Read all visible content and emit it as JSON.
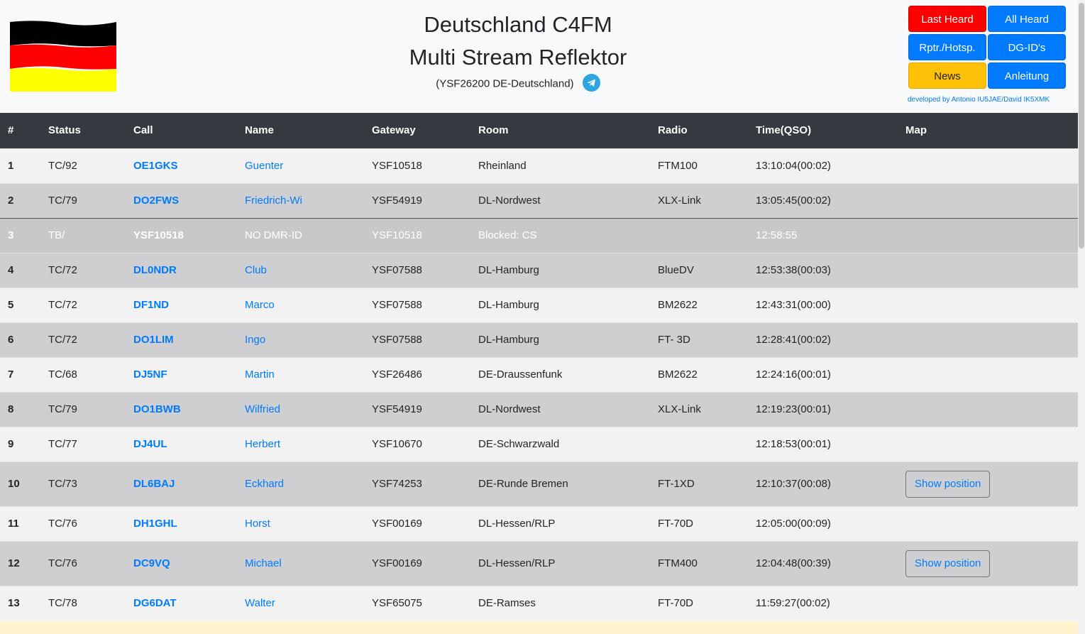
{
  "header": {
    "title_line1": "Deutschland C4FM",
    "title_line2": "Multi Stream Reflektor",
    "subtitle": "(YSF26200 DE-Deutschland)",
    "developer_credit": "developed by Antonio IU5JAE/David IK5XMK"
  },
  "nav": {
    "last_heard": "Last Heard",
    "all_heard": "All Heard",
    "rptr_hotsp": "Rptr./Hotsp.",
    "dg_ids": "DG-ID's",
    "news": "News",
    "anleitung": "Anleitung"
  },
  "table": {
    "headers": [
      "#",
      "Status",
      "Call",
      "Name",
      "Gateway",
      "Room",
      "Radio",
      "Time(QSO)",
      "Map"
    ],
    "rows": [
      {
        "num": "1",
        "status": "TC/92",
        "call": "OE1GKS",
        "name": "Guenter",
        "gateway": "YSF10518",
        "room": "Rheinland",
        "radio": "FTM100",
        "time": "13:10:04(00:02)",
        "map": ""
      },
      {
        "num": "2",
        "status": "TC/79",
        "call": "DO2FWS",
        "name": "Friedrich-Wi",
        "gateway": "YSF54919",
        "room": "DL-Nordwest",
        "radio": "XLX-Link",
        "time": "13:05:45(00:02)",
        "map": ""
      },
      {
        "num": "3",
        "status": "TB/",
        "call": "YSF10518",
        "name": "NO DMR-ID",
        "gateway": "YSF10518",
        "room": "Blocked: CS",
        "radio": "",
        "time": "12:58:55",
        "map": ""
      },
      {
        "num": "4",
        "status": "TC/72",
        "call": "DL0NDR",
        "name": "Club",
        "gateway": "YSF07588",
        "room": "DL-Hamburg",
        "radio": "BlueDV",
        "time": "12:53:38(00:03)",
        "map": ""
      },
      {
        "num": "5",
        "status": "TC/72",
        "call": "DF1ND",
        "name": "Marco",
        "gateway": "YSF07588",
        "room": "DL-Hamburg",
        "radio": "BM2622",
        "time": "12:43:31(00:00)",
        "map": ""
      },
      {
        "num": "6",
        "status": "TC/72",
        "call": "DO1LIM",
        "name": "Ingo",
        "gateway": "YSF07588",
        "room": "DL-Hamburg",
        "radio": "FT- 3D",
        "time": "12:28:41(00:02)",
        "map": ""
      },
      {
        "num": "7",
        "status": "TC/68",
        "call": "DJ5NF",
        "name": "Martin",
        "gateway": "YSF26486",
        "room": "DE-Draussenfunk",
        "radio": "BM2622",
        "time": "12:24:16(00:01)",
        "map": ""
      },
      {
        "num": "8",
        "status": "TC/79",
        "call": "DO1BWB",
        "name": "Wilfried",
        "gateway": "YSF54919",
        "room": "DL-Nordwest",
        "radio": "XLX-Link",
        "time": "12:19:23(00:01)",
        "map": ""
      },
      {
        "num": "9",
        "status": "TC/77",
        "call": "DJ4UL",
        "name": "Herbert",
        "gateway": "YSF10670",
        "room": "DE-Schwarzwald",
        "radio": "",
        "time": "12:18:53(00:01)",
        "map": ""
      },
      {
        "num": "10",
        "status": "TC/73",
        "call": "DL6BAJ",
        "name": "Eckhard",
        "gateway": "YSF74253",
        "room": "DE-Runde Bremen",
        "radio": "FT-1XD",
        "time": "12:10:37(00:08)",
        "map": "Show position"
      },
      {
        "num": "11",
        "status": "TC/76",
        "call": "DH1GHL",
        "name": "Horst",
        "gateway": "YSF00169",
        "room": "DL-Hessen/RLP",
        "radio": "FT-70D",
        "time": "12:05:00(00:09)",
        "map": ""
      },
      {
        "num": "12",
        "status": "TC/76",
        "call": "DC9VQ",
        "name": "Michael",
        "gateway": "YSF00169",
        "room": "DL-Hessen/RLP",
        "radio": "FTM400",
        "time": "12:04:48(00:39)",
        "map": "Show position"
      },
      {
        "num": "13",
        "status": "TC/78",
        "call": "DG6DAT",
        "name": "Walter",
        "gateway": "YSF65075",
        "room": "DE-Ramses",
        "radio": "FT-70D",
        "time": "11:59:27(00:02)",
        "map": ""
      }
    ]
  },
  "colors": {
    "accent": "#007bff",
    "header_bg": "#343a40",
    "last_heard_btn": "#ff0000",
    "news_btn": "#ffc107",
    "telegram": "#2ca5e0"
  },
  "icons": {
    "flag": "germany-flag-icon",
    "telegram": "telegram-icon"
  }
}
